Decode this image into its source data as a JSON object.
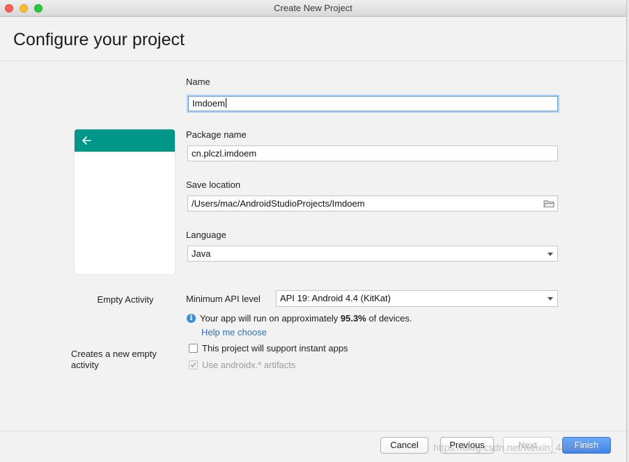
{
  "window": {
    "title": "Create New Project",
    "controls": [
      "close-window-icon",
      "minimize-window-icon",
      "zoom-window-icon"
    ]
  },
  "header": {
    "title": "Configure your project"
  },
  "preview": {
    "back_icon": "arrow-left-icon",
    "activity_name": "Empty Activity",
    "description": "Creates a new empty activity"
  },
  "form": {
    "name": {
      "label": "Name",
      "value": "Imdoem"
    },
    "package": {
      "label": "Package name",
      "value": "cn.plczl.imdoem"
    },
    "save_location": {
      "label": "Save location",
      "value": "/Users/mac/AndroidStudioProjects/Imdoem",
      "icon": "folder-icon"
    },
    "language": {
      "label": "Language",
      "value": "Java"
    },
    "min_api": {
      "label": "Minimum API level",
      "value": "API 19: Android 4.4 (KitKat)"
    },
    "api_info": {
      "icon": "info-icon",
      "prefix": "Your app will run on approximately",
      "percent": "95.3%",
      "suffix": "of devices."
    },
    "help_link": "Help me choose",
    "instant_apps": {
      "label": "This project will support instant apps",
      "checked": false,
      "enabled": true
    },
    "androidx": {
      "label": "Use androidx.* artifacts",
      "checked": true,
      "enabled": false
    }
  },
  "buttons": {
    "cancel": "Cancel",
    "previous": "Previous",
    "next": "Next",
    "finish": "Finish"
  },
  "watermark": "https://blog.csdn.net/weixin_44880903",
  "colors": {
    "appbar": "#009688",
    "focus": "#6a9fe0",
    "link": "#2f6fc0",
    "primary_button": "#3f83ea"
  }
}
